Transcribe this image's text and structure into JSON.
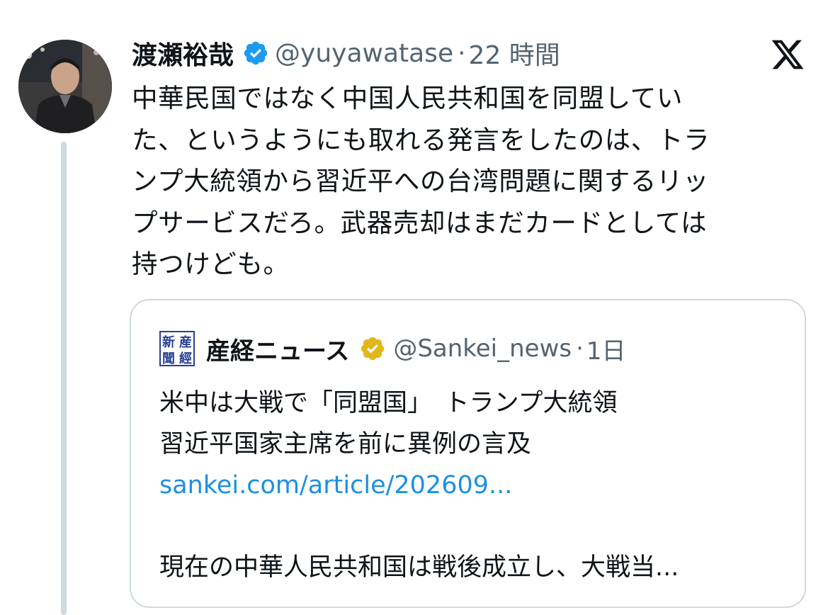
{
  "tweet": {
    "display_name": "渡瀬裕哉",
    "handle": "@yuyawatase",
    "separator": "·",
    "time": "22 時間",
    "body": "中華民国ではなく中国人民共和国を同盟してい\nた、というようにも取れる発言をしたのは、トラ\nンプ大統領から習近平への台湾問題に関するリッ\nプサービスだろ。武器売却はまだカードとしては\n持つけども。"
  },
  "quote": {
    "logo_text": "産經新聞",
    "display_name": "産経ニュース",
    "handle": "@Sankei_news",
    "separator": "·",
    "time": "1日",
    "body": "米中は大戦で「同盟国」　トランプ大統領\n習近平国家主席を前に異例の言及",
    "link": "sankei.com/article/202609...",
    "body2": "現在の中華人民共和国は戦後成立し、大戦当..."
  },
  "icons": {
    "x_logo": "x-logo-icon",
    "verified": "verified-badge-icon",
    "gold_verified": "gold-verified-badge-icon"
  },
  "colors": {
    "verified_blue": "#1d9bf0",
    "verified_gold": "#e2b719",
    "link": "#1d8fe0",
    "secondary_text": "#536471",
    "border": "#cfd9de"
  }
}
